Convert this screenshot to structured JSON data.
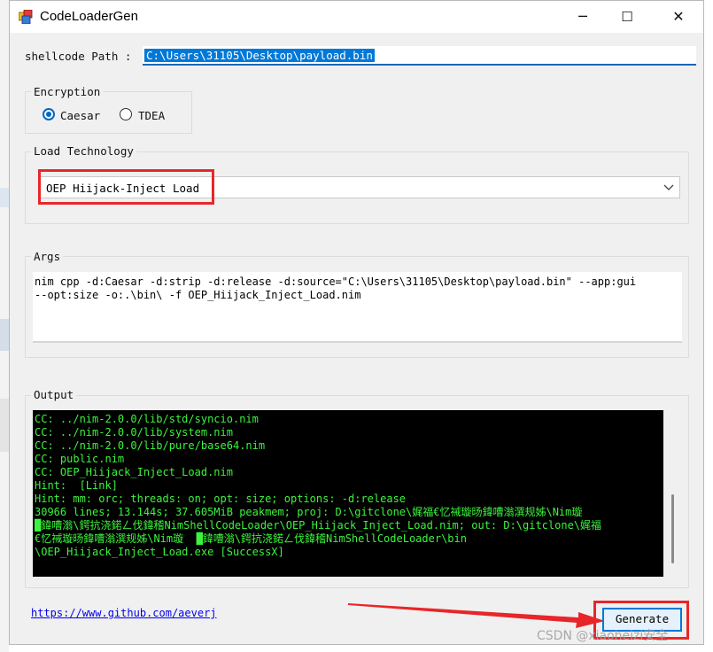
{
  "window": {
    "title": "CodeLoaderGen",
    "buttons": {
      "minimize": "─",
      "maximize": "☐",
      "close": "✕"
    }
  },
  "shellcode": {
    "label": "shellcode Path :",
    "value": "C:\\Users\\31105\\Desktop\\payload.bin"
  },
  "encryption": {
    "caption": "Encryption",
    "options": [
      {
        "label": "Caesar",
        "selected": true
      },
      {
        "label": "TDEA",
        "selected": false
      }
    ]
  },
  "load_technology": {
    "caption": "Load Technology",
    "selected": "OEP Hiijack-Inject Load"
  },
  "args": {
    "caption": "Args",
    "lines": [
      "nim cpp -d:Caesar -d:strip -d:release -d:source=\"C:\\Users\\31105\\Desktop\\payload.bin\" --app:gui",
      "--opt:size -o:.\\bin\\ -f OEP_Hiijack_Inject_Load.nim"
    ]
  },
  "output": {
    "caption": "Output",
    "lines": [
      "CC: ../nim-2.0.0/lib/std/syncio.nim",
      "CC: ../nim-2.0.0/lib/system.nim",
      "CC: ../nim-2.0.0/lib/pure/base64.nim",
      "CC: public.nim",
      "CC: OEP_Hiijack_Inject_Load.nim",
      "Hint:  [Link]",
      "Hint: mm: orc; threads: on; opt: size; options: -d:release",
      "30966 lines; 13.144s; 37.605MiB peakmem; proj: D:\\gitclone\\娓福€忆祴璇旸鍏嘈滃潠规姊\\Nim璇",
      "█鍏嘈滃\\鍔抗浇鍩ㄥ伐鍏稽NimShellCodeLoader\\OEP_Hiijack_Inject_Load.nim; out: D:\\gitclone\\娓福",
      "€忆祴璇旸鍏嘈滃潠规姊\\Nim璇  █鍏嘈滃\\鍔抗浇鍩ㄥ伐鍏稽NimShellCodeLoader\\bin",
      "\\OEP_Hiijack_Inject_Load.exe [SuccessX]"
    ]
  },
  "footer": {
    "link": "https://www.github.com/aeverj",
    "generate_label": "Generate"
  },
  "watermark": "CSDN @xiaoheizi安全",
  "colors": {
    "accent": "#0078d7",
    "console_text": "#3cf43c",
    "highlight_box": "#e8262a"
  }
}
